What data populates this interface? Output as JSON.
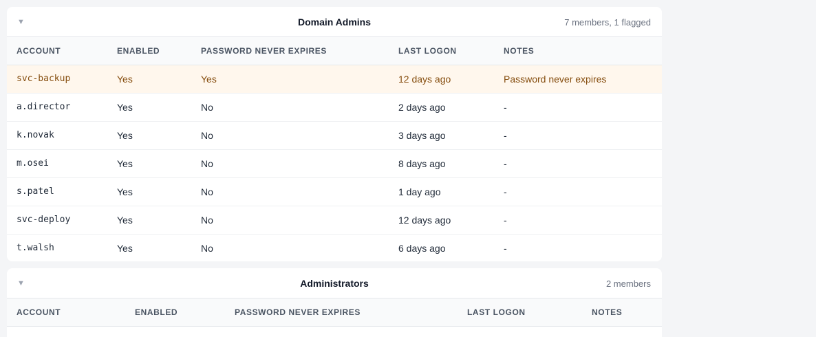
{
  "colors": {
    "flagged_row_bg": "#fff7ed",
    "flagged_text": "#854d0e"
  },
  "groups": [
    {
      "title": "Domain Admins",
      "count": "7 members, 1 flagged",
      "chevron_icon": "triangle-down-icon",
      "columns": [
        "ACCOUNT",
        "ENABLED",
        "PASSWORD NEVER EXPIRES",
        "LAST LOGON",
        "NOTES"
      ],
      "rows": [
        {
          "account": "svc-backup",
          "enabled": "Yes",
          "pne": "Yes",
          "last_logon": "12 days ago",
          "notes": "Password never expires",
          "flagged": true
        },
        {
          "account": "a.director",
          "enabled": "Yes",
          "pne": "No",
          "last_logon": "2 days ago",
          "notes": "-",
          "flagged": false
        },
        {
          "account": "k.novak",
          "enabled": "Yes",
          "pne": "No",
          "last_logon": "3 days ago",
          "notes": "-",
          "flagged": false
        },
        {
          "account": "m.osei",
          "enabled": "Yes",
          "pne": "No",
          "last_logon": "8 days ago",
          "notes": "-",
          "flagged": false
        },
        {
          "account": "s.patel",
          "enabled": "Yes",
          "pne": "No",
          "last_logon": "1 day ago",
          "notes": "-",
          "flagged": false
        },
        {
          "account": "svc-deploy",
          "enabled": "Yes",
          "pne": "No",
          "last_logon": "12 days ago",
          "notes": "-",
          "flagged": false
        },
        {
          "account": "t.walsh",
          "enabled": "Yes",
          "pne": "No",
          "last_logon": "6 days ago",
          "notes": "-",
          "flagged": false
        }
      ]
    },
    {
      "title": "Administrators",
      "count": "2 members",
      "chevron_icon": "triangle-down-icon",
      "columns": [
        "ACCOUNT",
        "ENABLED",
        "PASSWORD NEVER EXPIRES",
        "LAST LOGON",
        "NOTES"
      ]
    }
  ]
}
